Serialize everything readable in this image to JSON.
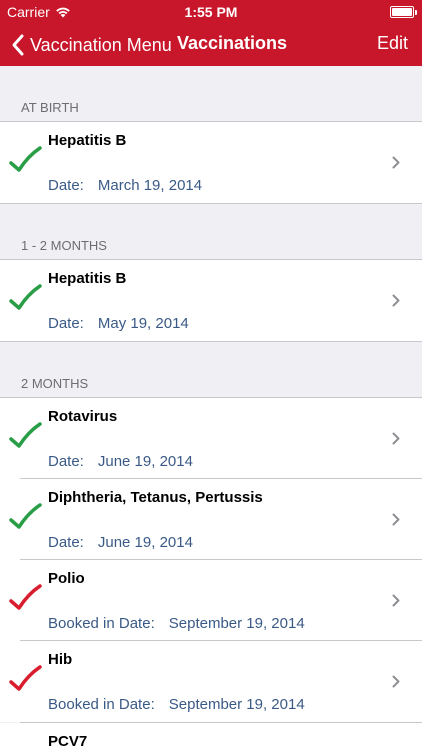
{
  "status_bar": {
    "carrier": "Carrier",
    "time": "1:55 PM"
  },
  "nav": {
    "back_label": "Vaccination Menu",
    "title": "Vaccinations",
    "edit_label": "Edit"
  },
  "colors": {
    "nav_bg": "#c8172b",
    "check_done": "#2a9d47",
    "check_booked": "#d81e2e",
    "date_text": "#3a5a86"
  },
  "sections": [
    {
      "header": "AT BIRTH",
      "rows": [
        {
          "name": "Hepatitis B",
          "date_label": "Date:",
          "date_value": "March 19, 2014",
          "status": "done",
          "icon": "green-check-icon"
        }
      ]
    },
    {
      "header": "1 - 2 MONTHS",
      "rows": [
        {
          "name": "Hepatitis B",
          "date_label": "Date:",
          "date_value": "May 19, 2014",
          "status": "done",
          "icon": "green-check-icon"
        }
      ]
    },
    {
      "header": "2 MONTHS",
      "rows": [
        {
          "name": "Rotavirus",
          "date_label": "Date:",
          "date_value": "June 19, 2014",
          "status": "done",
          "icon": "green-check-icon"
        },
        {
          "name": "Diphtheria, Tetanus, Pertussis",
          "date_label": "Date:",
          "date_value": "June 19, 2014",
          "status": "done",
          "icon": "green-check-icon"
        },
        {
          "name": "Polio",
          "date_label": "Booked in Date:",
          "date_value": "September 19, 2014",
          "status": "booked",
          "icon": "red-check-icon"
        },
        {
          "name": "Hib",
          "date_label": "Booked in Date:",
          "date_value": "September 19, 2014",
          "status": "booked",
          "icon": "red-check-icon"
        },
        {
          "name": "PCV7",
          "date_label": "",
          "date_value": "",
          "status": "",
          "icon": ""
        }
      ]
    }
  ]
}
